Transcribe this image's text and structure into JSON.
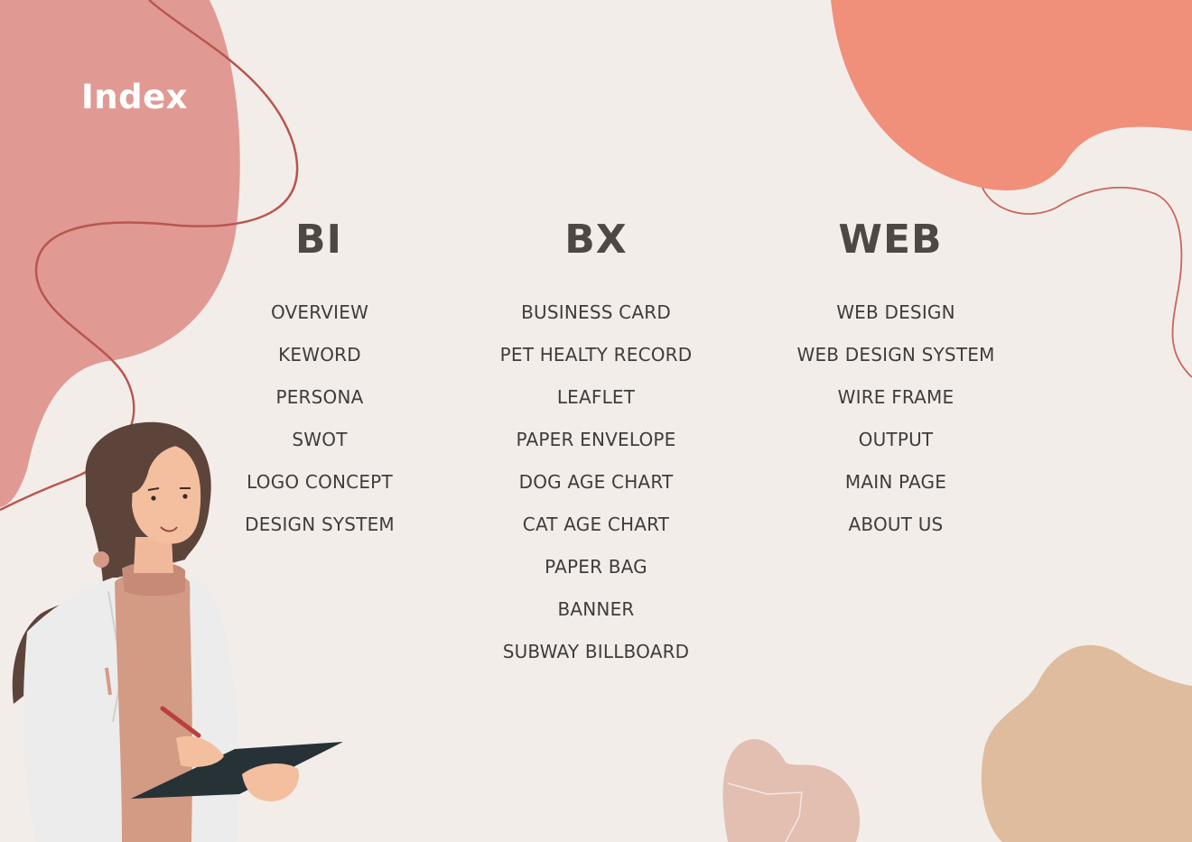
{
  "page": {
    "title": "Index",
    "background": "#f3edea",
    "accent_colors": {
      "top_left_blob": "#e09a93",
      "top_right_blob": "#f0907a",
      "bottom_right_blob": "#dfbc9d",
      "heart": "#e2bfb1",
      "line": "#b8564e",
      "text": "#4e4843"
    }
  },
  "illustration": {
    "name": "woman-doctor-with-clipboard",
    "icon": "person-illustration"
  },
  "columns": [
    {
      "heading": "BI",
      "items": [
        "OVERVIEW",
        "KEWORD",
        "PERSONA",
        "SWOT",
        "LOGO CONCEPT",
        "DESIGN SYSTEM"
      ]
    },
    {
      "heading": "BX",
      "items": [
        "BUSINESS CARD",
        "PET HEALTY RECORD",
        "LEAFLET",
        "PAPER ENVELOPE",
        "DOG AGE CHART",
        "CAT AGE CHART",
        "PAPER BAG",
        "BANNER",
        "SUBWAY BILLBOARD"
      ]
    },
    {
      "heading": "WEB",
      "items": [
        "WEB DESIGN",
        "WEB DESIGN SYSTEM",
        "WIRE FRAME",
        "OUTPUT",
        "MAIN PAGE",
        "ABOUT US"
      ]
    }
  ]
}
